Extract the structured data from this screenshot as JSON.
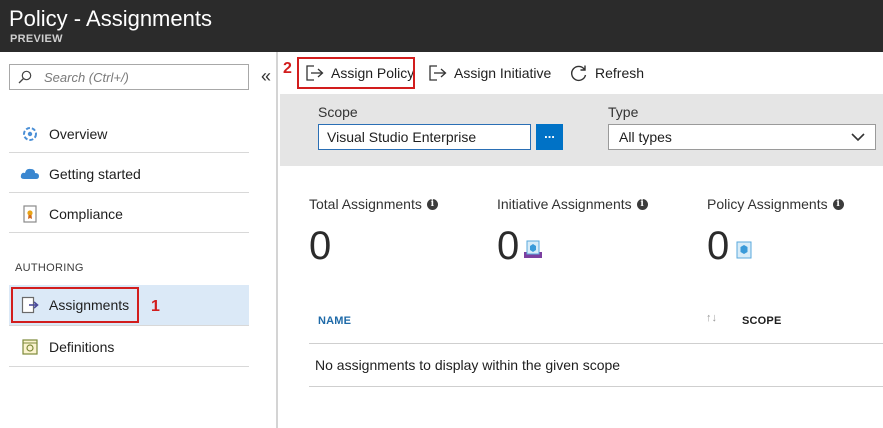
{
  "header": {
    "title": "Policy - Assignments",
    "subtitle": "PREVIEW"
  },
  "sidebar": {
    "search_placeholder": "Search (Ctrl+/)",
    "collapse_label": "«",
    "items": [
      {
        "label": "Overview",
        "icon": "overview-icon"
      },
      {
        "label": "Getting started",
        "icon": "cloud-icon"
      },
      {
        "label": "Compliance",
        "icon": "compliance-icon"
      }
    ],
    "section_label": "AUTHORING",
    "authoring_items": [
      {
        "label": "Assignments",
        "icon": "assignments-icon",
        "active": true
      },
      {
        "label": "Definitions",
        "icon": "definitions-icon"
      }
    ]
  },
  "annotations": {
    "marker_1": "1",
    "marker_2": "2"
  },
  "toolbar": {
    "assign_policy": "Assign Policy",
    "assign_initiative": "Assign Initiative",
    "refresh": "Refresh"
  },
  "filters": {
    "scope_label": "Scope",
    "scope_value": "Visual Studio Enterprise",
    "scope_button": "...",
    "type_label": "Type",
    "type_value": "All types"
  },
  "stats": {
    "total": {
      "label": "Total Assignments",
      "value": "0"
    },
    "initiative": {
      "label": "Initiative Assignments",
      "value": "0"
    },
    "policy": {
      "label": "Policy Assignments",
      "value": "0"
    }
  },
  "table": {
    "columns": [
      "NAME",
      "SCOPE"
    ],
    "sort_glyph": "↑↓",
    "empty_message": "No assignments to display within the given scope"
  },
  "colors": {
    "header_bg": "#2b2b2b",
    "accent": "#0072c6",
    "active_item_bg": "#dbe9f7",
    "annotation_red": "#d21d1d",
    "filter_bg": "#e5e5e5"
  }
}
